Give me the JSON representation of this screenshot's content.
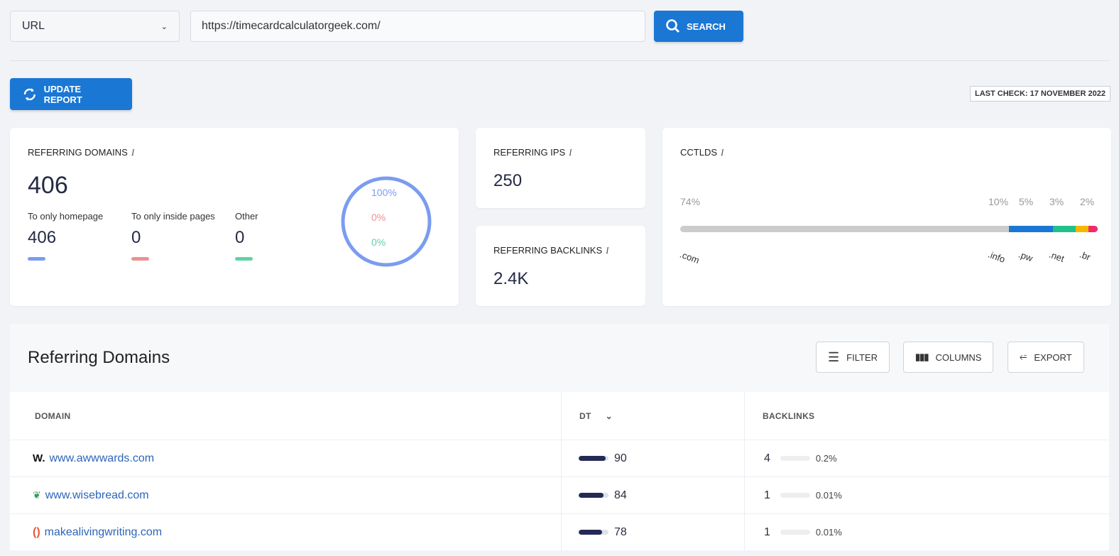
{
  "search": {
    "type": "URL",
    "url": "https://timecardcalculatorgeek.com/",
    "button": "SEARCH"
  },
  "update_button": "UPDATE REPORT",
  "last_check": "LAST CHECK: 17 NOVEMBER 2022",
  "referring_domains": {
    "title": "REFERRING DOMAINS",
    "total": "406",
    "breakdown": [
      {
        "label": "To only homepage",
        "value": "406",
        "color": "#7b9cf0"
      },
      {
        "label": "To only inside pages",
        "value": "0",
        "color": "#ef8f8f"
      },
      {
        "label": "Other",
        "value": "0",
        "color": "#5fd3a5"
      }
    ],
    "donut": [
      "100%",
      "0%",
      "0%"
    ]
  },
  "referring_ips": {
    "title": "REFERRING IPS",
    "value": "250"
  },
  "referring_backlinks": {
    "title": "REFERRING BACKLINKS",
    "value": "2.4K"
  },
  "cctlds": {
    "title": "CCTLDS",
    "items": [
      {
        "tld": ".com",
        "pct": "74%",
        "value": 74,
        "color": "#cccccc"
      },
      {
        "tld": ".info",
        "pct": "10%",
        "value": 10,
        "color": "#1a77d4"
      },
      {
        "tld": ".pw",
        "pct": "5%",
        "value": 5,
        "color": "#22c08a"
      },
      {
        "tld": ".net",
        "pct": "3%",
        "value": 3,
        "color": "#f5b800"
      },
      {
        "tld": ".br",
        "pct": "2%",
        "value": 2,
        "color": "#ef2a6e"
      }
    ]
  },
  "table": {
    "title": "Referring Domains",
    "filter": "FILTER",
    "columns": "COLUMNS",
    "export": "EXPORT",
    "headers": [
      "DOMAIN",
      "DT",
      "BACKLINKS"
    ],
    "rows": [
      {
        "domain": "www.awwwards.com",
        "dt": "90",
        "dt_value": 90,
        "backlinks": "4",
        "share": "0.2%",
        "share_value": 0.2,
        "icon": "W."
      },
      {
        "domain": "www.wisebread.com",
        "dt": "84",
        "dt_value": 84,
        "backlinks": "1",
        "share": "0.01%",
        "share_value": 0.01,
        "icon": "leaf"
      },
      {
        "domain": "makealivingwriting.com",
        "dt": "78",
        "dt_value": 78,
        "backlinks": "1",
        "share": "0.01%",
        "share_value": 0.01,
        "icon": "bracket"
      }
    ]
  }
}
